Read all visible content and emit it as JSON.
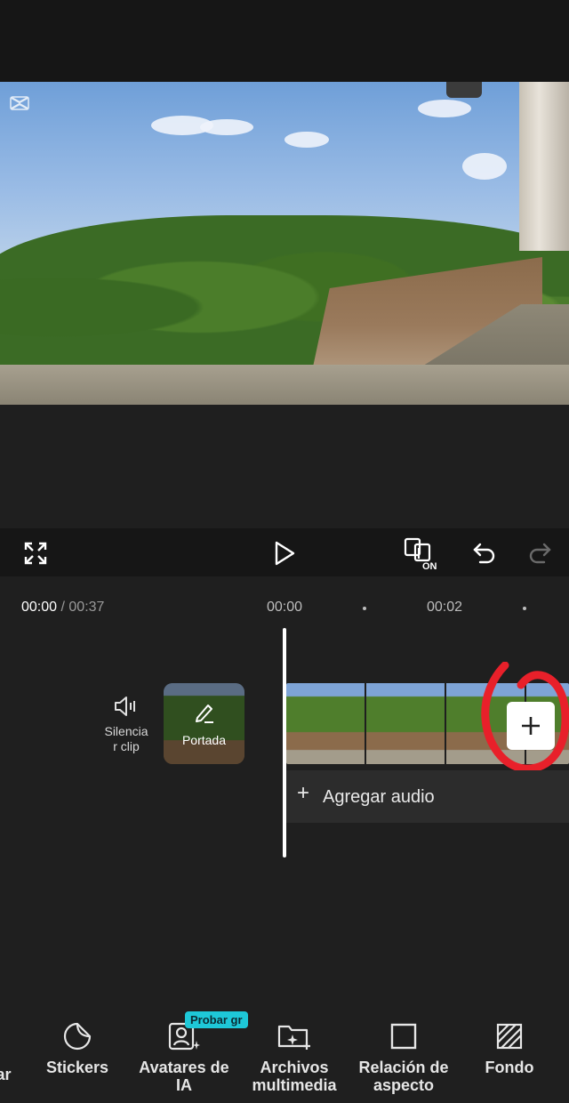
{
  "timeline": {
    "current_time": "00:00",
    "separator": " / ",
    "total_time": "00:37",
    "ticks": [
      "00:00",
      "00:02"
    ]
  },
  "track": {
    "mute_label": "Silencia\nr clip",
    "cover_label": "Portada",
    "add_audio_label": "Agregar audio",
    "add_audio_plus": "+"
  },
  "toolbar": {
    "partial_left": "ar",
    "stickers": "Stickers",
    "avatars": "Avatares de IA",
    "avatars_badge": "Probar gr",
    "media": "Archivos multimedia",
    "aspect": "Relación de aspecto",
    "background": "Fondo"
  },
  "colors": {
    "accent_badge": "#1ec8d8",
    "annotation": "#e8202a"
  },
  "icons": {
    "fullscreen": "expand-icon",
    "play": "play-icon",
    "autocut": "autocut-on-icon",
    "undo": "undo-icon",
    "redo": "redo-icon"
  }
}
